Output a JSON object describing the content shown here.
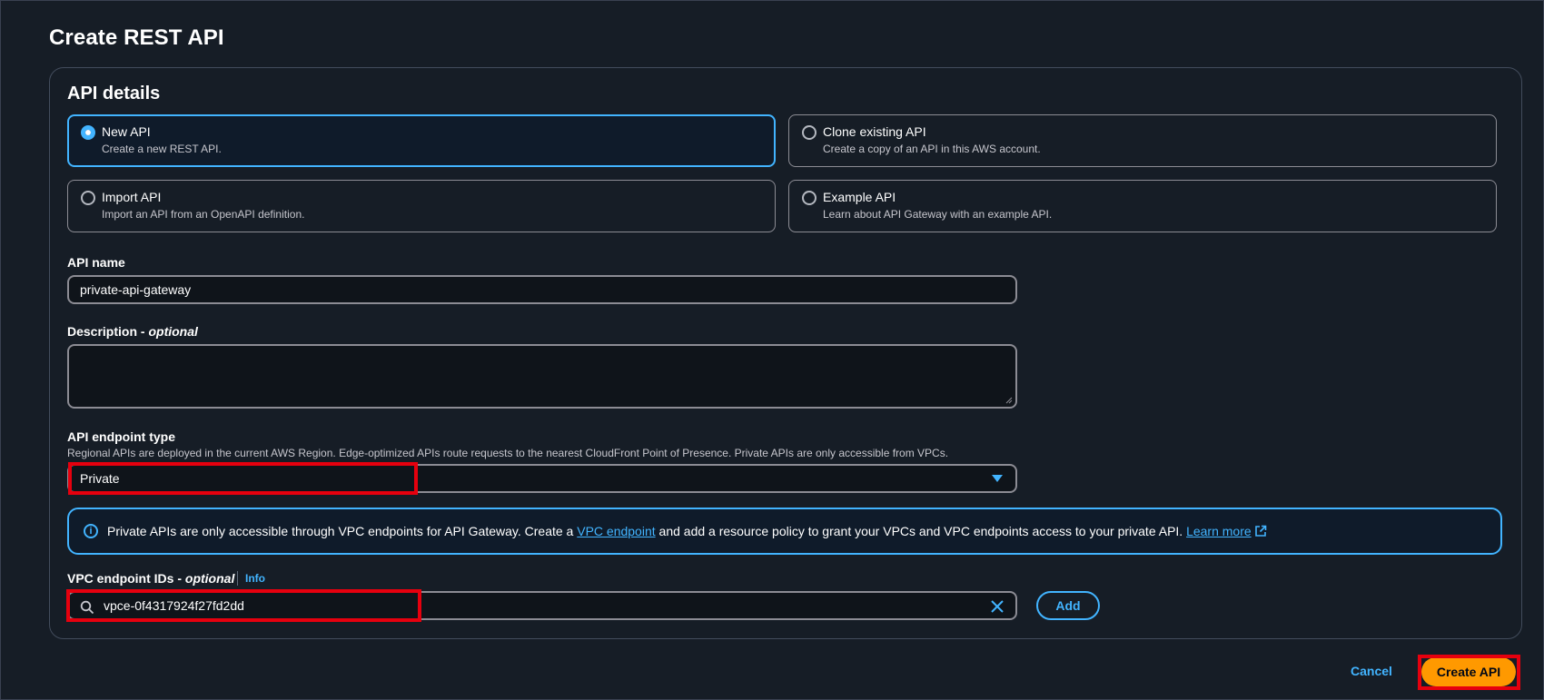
{
  "page": {
    "title": "Create REST API"
  },
  "details": {
    "title": "API details"
  },
  "api_options": [
    {
      "label": "New API",
      "description": "Create a new REST API.",
      "selected": true
    },
    {
      "label": "Clone existing API",
      "description": "Create a copy of an API in this AWS account.",
      "selected": false
    },
    {
      "label": "Import API",
      "description": "Import an API from an OpenAPI definition.",
      "selected": false
    },
    {
      "label": "Example API",
      "description": "Learn about API Gateway with an example API.",
      "selected": false
    }
  ],
  "api_name": {
    "label": "API name",
    "value": "private-api-gateway"
  },
  "description": {
    "label": "Description",
    "optional": "optional",
    "value": ""
  },
  "endpoint_type": {
    "label": "API endpoint type",
    "hint": "Regional APIs are deployed in the current AWS Region. Edge-optimized APIs route requests to the nearest CloudFront Point of Presence. Private APIs are only accessible from VPCs.",
    "selected": "Private"
  },
  "alert": {
    "text_1": "Private APIs are only accessible through VPC endpoints for API Gateway. Create a ",
    "link_1": "VPC endpoint",
    "text_2": " and add a resource policy to grant your VPCs and VPC endpoints access to your private API. ",
    "link_2": "Learn more"
  },
  "vpc_endpoints": {
    "label": "VPC endpoint IDs",
    "optional": "optional",
    "info": "Info",
    "value": "vpce-0f4317924f27fd2dd",
    "add_label": "Add"
  },
  "footer": {
    "cancel_label": "Cancel",
    "create_label": "Create API"
  },
  "colors": {
    "accent": "#42b4ff",
    "primary_button": "#ff9900",
    "highlight": "#e6000e",
    "background": "#161d26"
  }
}
